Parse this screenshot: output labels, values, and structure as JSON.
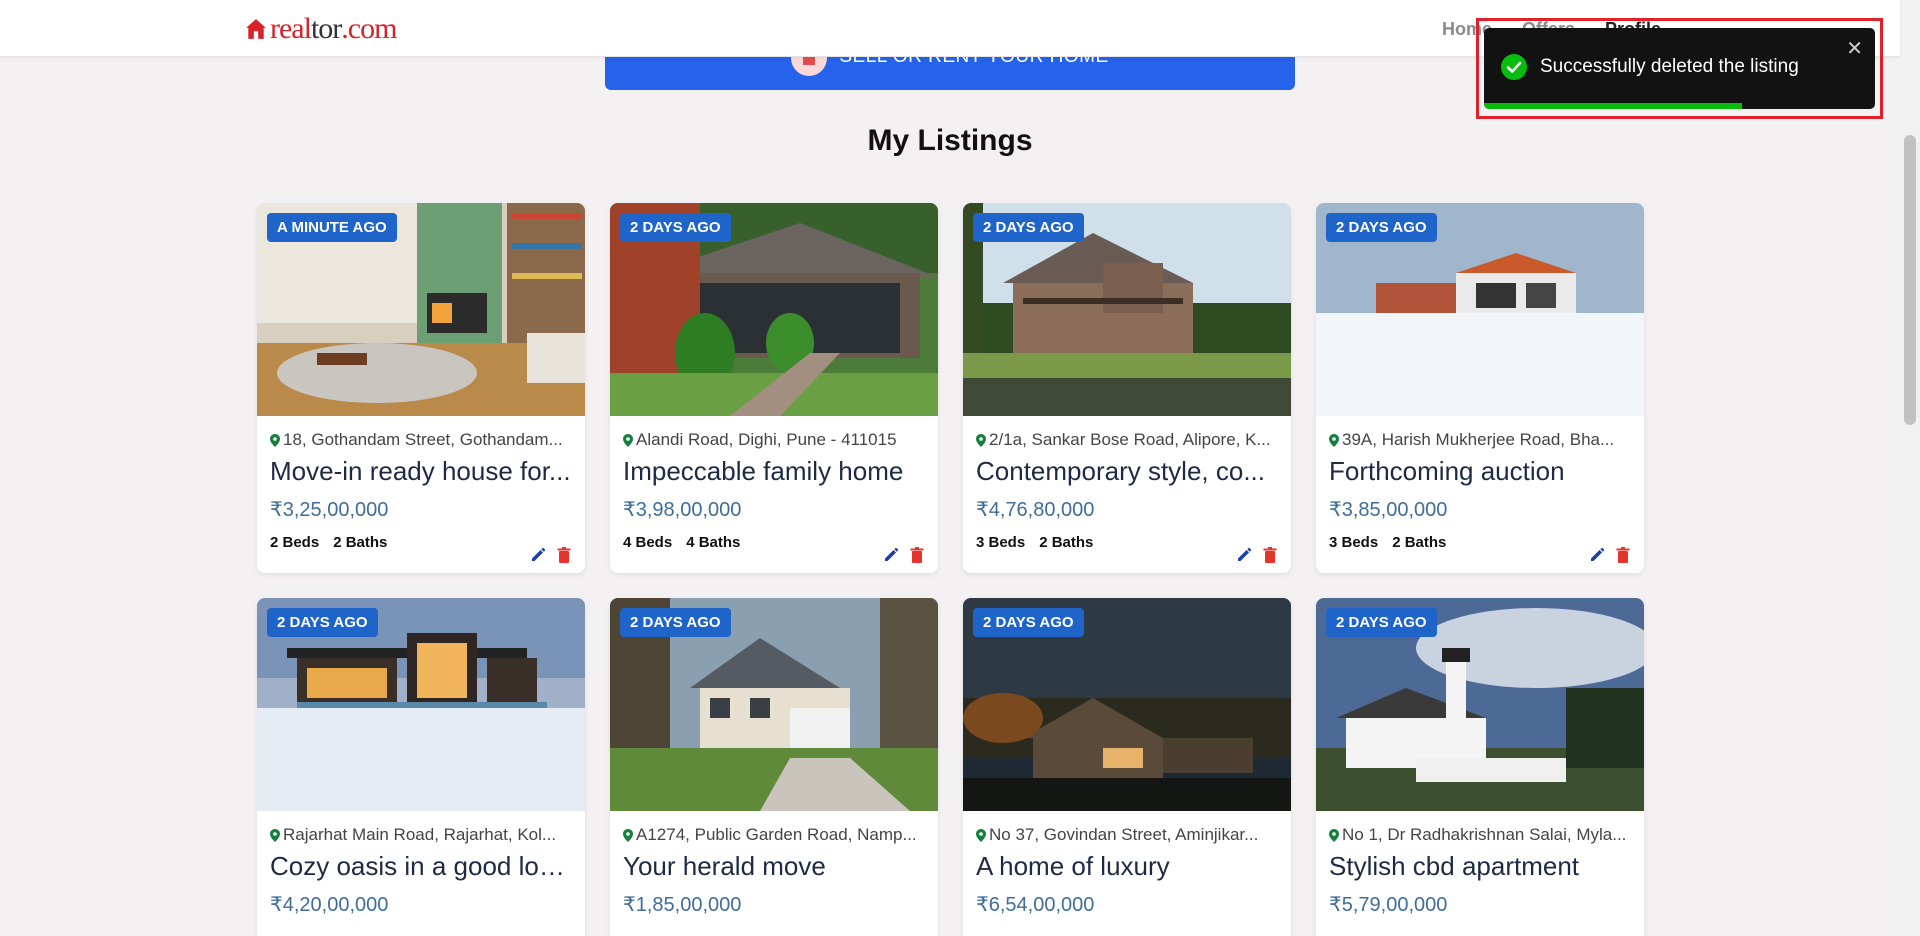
{
  "header": {
    "logo": {
      "part1": "real",
      "part2": "tor",
      "part3": ".com"
    },
    "nav": [
      "Home",
      "Offers",
      "Profile"
    ]
  },
  "sell_banner": {
    "label": "SELL OR RENT YOUR HOME"
  },
  "section_title": "My Listings",
  "toast": {
    "message": "Successfully deleted the listing",
    "close": "✕",
    "progress_fraction": 0.66,
    "accent": "#07bc0c"
  },
  "listings": [
    {
      "badge": "A MINUTE AGO",
      "address": "18, Gothandam Street, Gothandam...",
      "title": "Move-in ready house for...",
      "price": "₹3,25,00,000",
      "beds": "2 Beds",
      "baths": "2 Baths",
      "image": "living-room",
      "actions": true
    },
    {
      "badge": "2 DAYS AGO",
      "address": "Alandi Road, Dighi, Pune - 411015",
      "title": "Impeccable family home",
      "price": "₹3,98,00,000",
      "beds": "4 Beds",
      "baths": "4 Baths",
      "image": "garden-house",
      "actions": true
    },
    {
      "badge": "2 DAYS AGO",
      "address": "2/1a, Sankar Bose Road, Alipore, K...",
      "title": "Contemporary style, co...",
      "price": "₹4,76,80,000",
      "beds": "3 Beds",
      "baths": "2 Baths",
      "image": "lake-house",
      "actions": true
    },
    {
      "badge": "2 DAYS AGO",
      "address": "39A, Harish Mukherjee Road, Bha...",
      "title": "Forthcoming auction",
      "price": "₹3,85,00,000",
      "beds": "3 Beds",
      "baths": "2 Baths",
      "image": "snow-modern",
      "actions": true
    },
    {
      "badge": "2 DAYS AGO",
      "address": "Rajarhat Main Road, Rajarhat, Kol...",
      "title": "Cozy oasis in a good loc...",
      "price": "₹4,20,00,000",
      "image": "dusk-modern"
    },
    {
      "badge": "2 DAYS AGO",
      "address": "A1274, Public Garden Road, Namp...",
      "title": "Your herald move",
      "price": "₹1,85,00,000",
      "image": "suburban"
    },
    {
      "badge": "2 DAYS AGO",
      "address": "No 37, Govindan Street, Aminjikar...",
      "title": "A home of luxury",
      "price": "₹6,54,00,000",
      "image": "night-house"
    },
    {
      "badge": "2 DAYS AGO",
      "address": "No 1, Dr Radhakrishnan Salai, Myla...",
      "title": "Stylish cbd apartment",
      "price": "₹5,79,00,000",
      "image": "lighthouse"
    }
  ],
  "colors": {
    "badge": "#1f64c8",
    "price": "#3f6d9a",
    "primary": "#2563eb",
    "delete": "#e5352b",
    "edit": "#1d3fa8",
    "pin": "#15803d"
  }
}
